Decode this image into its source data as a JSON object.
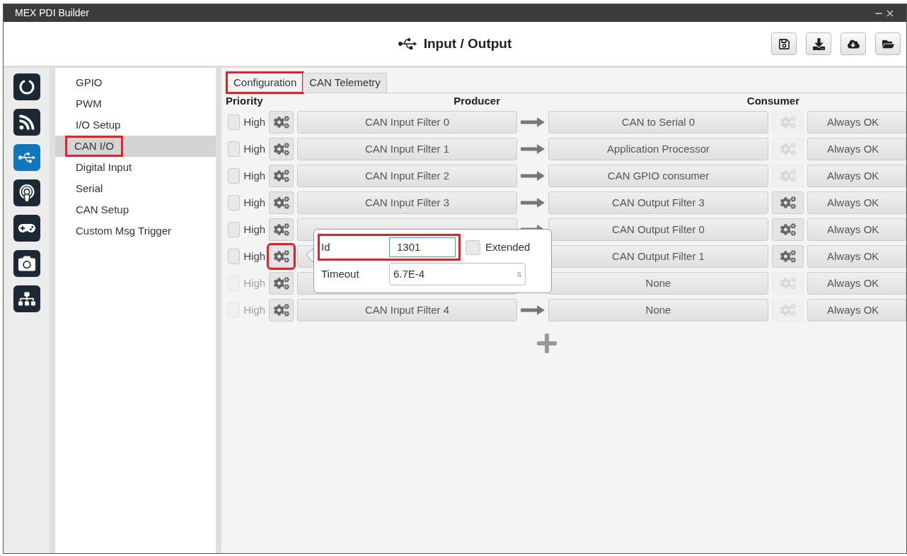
{
  "window": {
    "title": "MEX PDI Builder"
  },
  "header": {
    "title": "Input / Output"
  },
  "rail": [
    {
      "selected": false
    },
    {
      "selected": false
    },
    {
      "selected": true
    },
    {
      "selected": false
    },
    {
      "selected": false
    },
    {
      "selected": false
    },
    {
      "selected": false
    }
  ],
  "nav": [
    {
      "label": "GPIO",
      "selected": false,
      "highlighted": false
    },
    {
      "label": "PWM",
      "selected": false,
      "highlighted": false
    },
    {
      "label": "I/O Setup",
      "selected": false,
      "highlighted": false
    },
    {
      "label": "CAN I/O",
      "selected": true,
      "highlighted": true
    },
    {
      "label": "Digital Input",
      "selected": false,
      "highlighted": false
    },
    {
      "label": "Serial",
      "selected": false,
      "highlighted": false
    },
    {
      "label": "CAN Setup",
      "selected": false,
      "highlighted": false
    },
    {
      "label": "Custom Msg Trigger",
      "selected": false,
      "highlighted": false
    }
  ],
  "tabs": [
    {
      "label": "Configuration",
      "selected": true,
      "highlighted": true
    },
    {
      "label": "CAN Telemetry",
      "selected": false,
      "highlighted": false
    }
  ],
  "columns": [
    "Priority",
    "Producer",
    "Consumer"
  ],
  "rows": [
    {
      "priority": "High",
      "checked": false,
      "enabled": true,
      "gear_highlighted": false,
      "producer": "CAN Input Filter 0",
      "consumer": "CAN to Serial 0",
      "consumer_gear_enabled": false,
      "status": "Always OK"
    },
    {
      "priority": "High",
      "checked": false,
      "enabled": true,
      "gear_highlighted": false,
      "producer": "CAN Input Filter 1",
      "consumer": "Application Processor",
      "consumer_gear_enabled": false,
      "status": "Always OK"
    },
    {
      "priority": "High",
      "checked": false,
      "enabled": true,
      "gear_highlighted": false,
      "producer": "CAN Input Filter 2",
      "consumer": "CAN GPIO consumer",
      "consumer_gear_enabled": false,
      "status": "Always OK"
    },
    {
      "priority": "High",
      "checked": false,
      "enabled": true,
      "gear_highlighted": false,
      "producer": "CAN Input Filter 3",
      "consumer": "CAN Output Filter 3",
      "consumer_gear_enabled": true,
      "status": "Always OK"
    },
    {
      "priority": "High",
      "checked": false,
      "enabled": true,
      "gear_highlighted": false,
      "consumer": "CAN Output Filter 0",
      "consumer_gear_enabled": true,
      "status": "Always OK"
    },
    {
      "priority": "High",
      "checked": false,
      "enabled": true,
      "gear_highlighted": true,
      "consumer": "CAN Output Filter 1",
      "consumer_gear_enabled": true,
      "status": "Always OK"
    },
    {
      "priority": "High",
      "checked": false,
      "enabled": false,
      "gear_highlighted": false,
      "consumer": "None",
      "consumer_gear_enabled": false,
      "status": "Always OK"
    },
    {
      "priority": "High",
      "checked": false,
      "enabled": false,
      "gear_highlighted": false,
      "producer": "CAN Input Filter 4",
      "consumer": "None",
      "consumer_gear_enabled": false,
      "status": "Always OK"
    }
  ],
  "popover": {
    "id": {
      "label": "Id",
      "value": "1301",
      "highlighted": true,
      "extended": {
        "label": "Extended",
        "checked": false
      }
    },
    "timeout": {
      "label": "Timeout",
      "value": "6.7E-4",
      "unit": "s"
    }
  }
}
